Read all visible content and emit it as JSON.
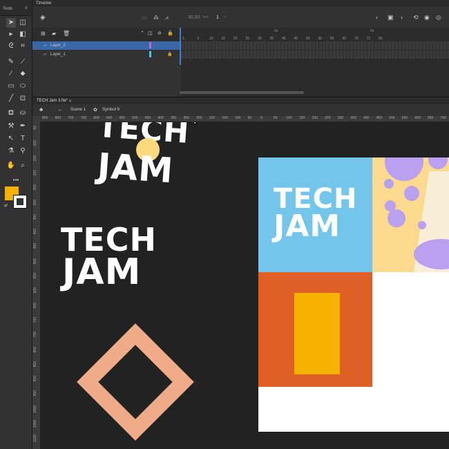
{
  "tools_panel": {
    "title": "Tools"
  },
  "timeline": {
    "tab_title": "Timeline",
    "fps": "30,00",
    "fps_unit": "FPS",
    "current_frame": "1",
    "frame_unit": "F",
    "seconds_marks": [
      "1s",
      "2s"
    ],
    "frame_numbers": [
      "1",
      "5",
      "10",
      "15",
      "20",
      "25",
      "30",
      "35",
      "40",
      "45",
      "50",
      "55",
      "60",
      "65",
      "70",
      "75",
      "80"
    ],
    "layers": [
      {
        "name": "Layer_2",
        "selected": true
      },
      {
        "name": "Layer_1",
        "selected": false
      }
    ]
  },
  "document": {
    "tab_title": "TECH Jam 3.fla*",
    "breadcrumb": {
      "scene": "Scene 1",
      "symbol": "Symbol 9"
    }
  },
  "rulers": {
    "horizontal": [
      "850",
      "800",
      "750",
      "700",
      "650",
      "600",
      "550",
      "500",
      "450",
      "400",
      "350",
      "300",
      "250",
      "200",
      "150",
      "100",
      "50",
      "0",
      "50",
      "100",
      "150",
      "200",
      "250",
      "300",
      "350",
      "400",
      "450",
      "500",
      "550",
      "600",
      "650",
      "700"
    ],
    "vertical": [
      "50",
      "100",
      "150",
      "200",
      "250",
      "300",
      "350",
      "400",
      "450",
      "500",
      "550",
      "600",
      "650",
      "700",
      "750",
      "800",
      "850",
      "900",
      "950",
      "1000",
      "1050",
      "1100"
    ]
  },
  "stage": {
    "logo_words": {
      "top": "TECH",
      "bottom": "JAM"
    },
    "colors": {
      "yellow": "#f7c800",
      "orange": "#df5f25",
      "light_blue": "#74c5ec",
      "salmon": "#efab88",
      "circle_yellow": "#fbd97d",
      "purple": "#b9a0f0",
      "cream": "#fbd98d"
    }
  },
  "colors": {
    "fill_swatch": "#f7b200",
    "stroke_swatch": "#ffffff",
    "accent": "#3b80d6"
  }
}
